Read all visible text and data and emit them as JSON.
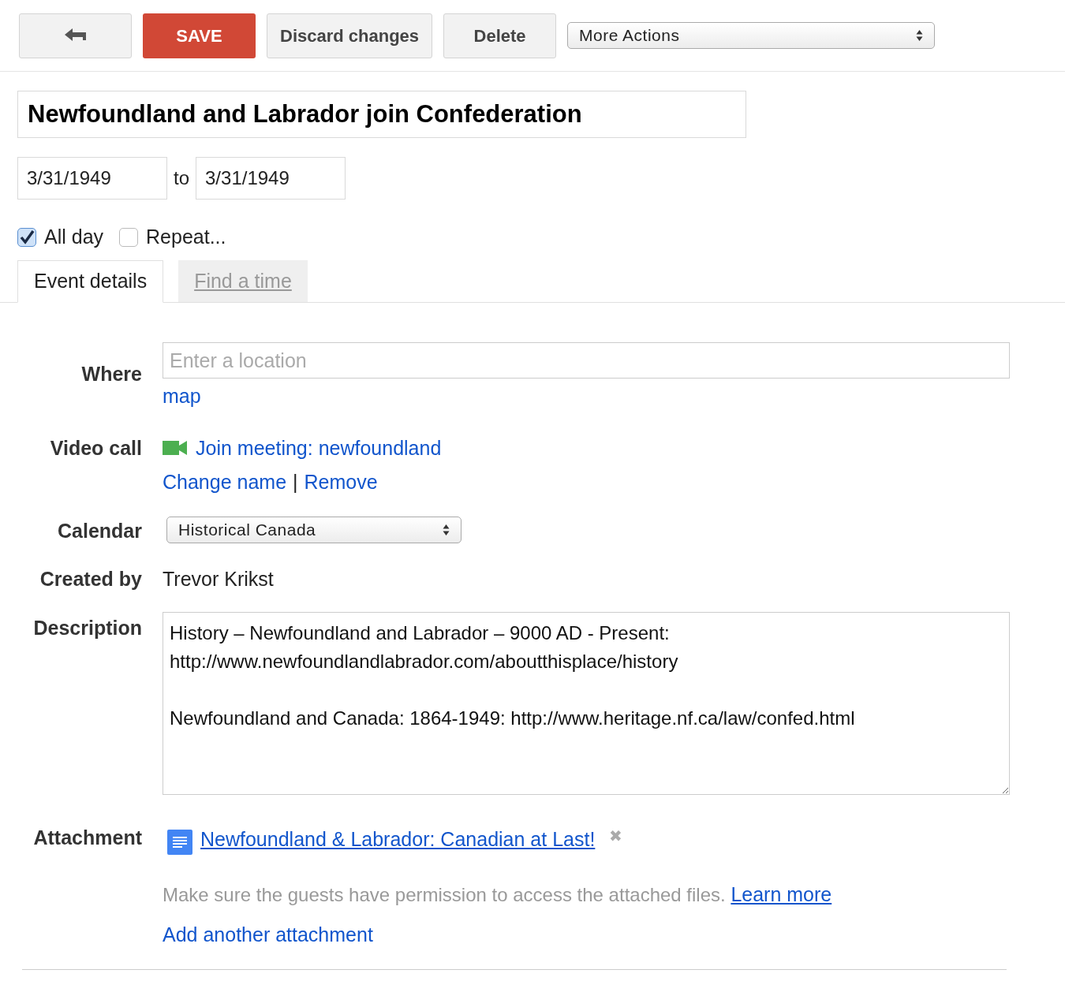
{
  "toolbar": {
    "buttons": [
      {
        "kind": "back"
      },
      {
        "kind": "primary",
        "label": "SAVE"
      },
      {
        "kind": "plain",
        "label": "Discard changes"
      },
      {
        "kind": "plain",
        "label": "Delete"
      }
    ],
    "more_actions": {
      "value": "More Actions"
    }
  },
  "event": {
    "title": "Newfoundland and Labrador join Confederation",
    "start_date": "3/31/1949",
    "to_label": "to",
    "end_date": "3/31/1949"
  },
  "options": [
    {
      "label": "All day",
      "checked": true
    },
    {
      "label": "Repeat...",
      "checked": false
    }
  ],
  "tabs": [
    {
      "label": "Event details",
      "selected": true
    },
    {
      "label": "Find a time",
      "selected": false
    }
  ],
  "form": {
    "where": {
      "label": "Where",
      "placeholder": "Enter a location",
      "link": "map"
    },
    "video_call": {
      "label": "Video call",
      "join": "Join meeting: newfoundland",
      "change": "Change name",
      "separator": "|",
      "remove": "Remove"
    },
    "calendar": {
      "label": "Calendar",
      "value": "Historical Canada"
    },
    "created_by": {
      "label": "Created by",
      "value": "Trevor Krikst"
    },
    "description": {
      "label": "Description",
      "paragraphs": [
        "History – Newfoundland and Labrador – 9000 AD - Present:\nhttp://www.newfoundlandlabrador.com/aboutthisplace/history",
        "Newfoundland and Canada: 1864-1949: http://www.heritage.nf.ca/law/confed.html"
      ]
    },
    "attachment": {
      "label": "Attachment",
      "file": "Newfoundland & Labrador: Canadian at Last!",
      "remove": "✖",
      "note": "Make sure the guests have permission to access the attached files.",
      "learn_more": "Learn more",
      "add": "Add another attachment"
    }
  }
}
